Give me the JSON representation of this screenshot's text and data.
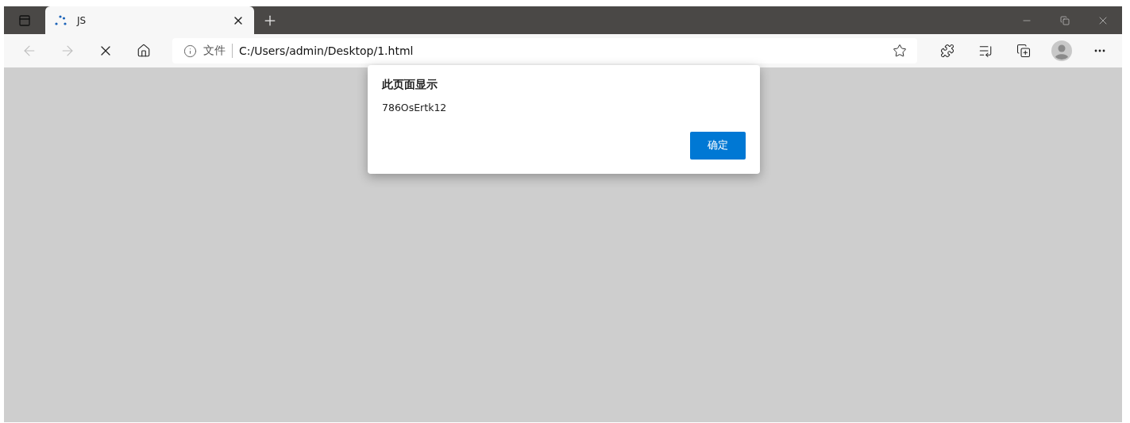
{
  "tabs": [
    {
      "title": "JS",
      "selected": true,
      "loading": true
    }
  ],
  "nav": {
    "back_disabled": true,
    "forward_disabled": true
  },
  "address_bar": {
    "security_label": "文件",
    "url": "C:/Users/admin/Desktop/1.html"
  },
  "dialog": {
    "title": "此页面显示",
    "message": "786OsErtk12",
    "buttons": [
      "确定"
    ]
  }
}
